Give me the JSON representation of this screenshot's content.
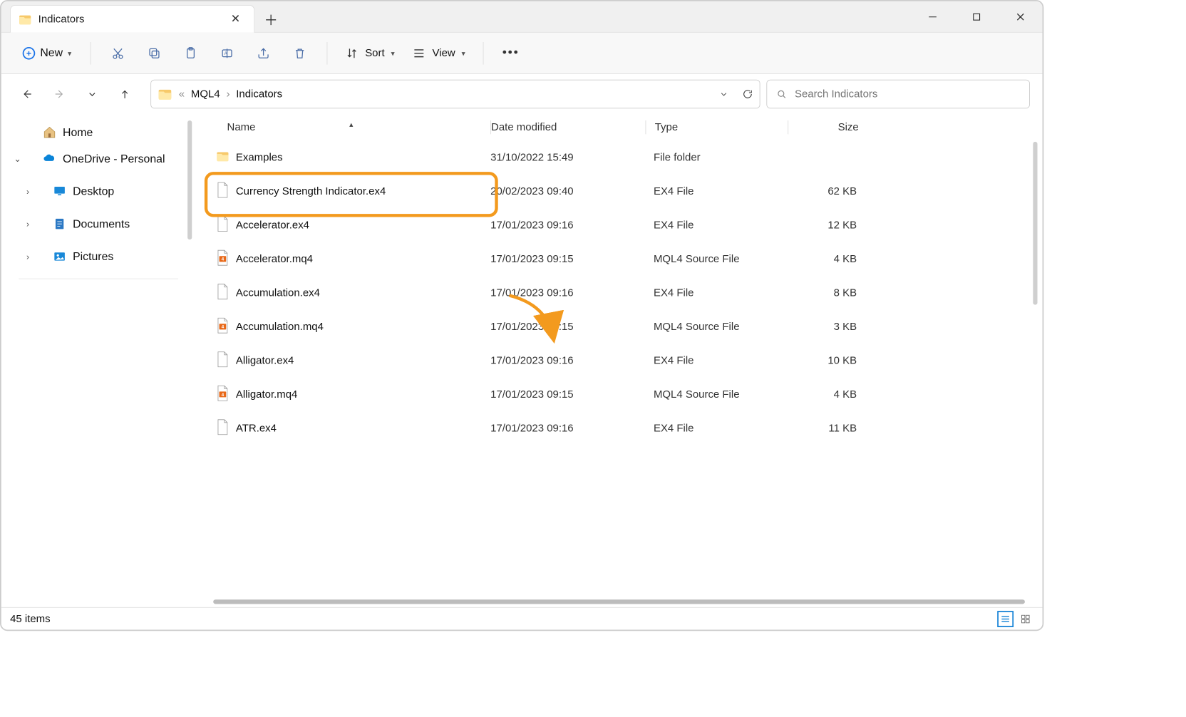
{
  "tab": {
    "title": "Indicators"
  },
  "toolbar": {
    "new_label": "New",
    "sort_label": "Sort",
    "view_label": "View"
  },
  "breadcrumb": {
    "part1": "MQL4",
    "part2": "Indicators"
  },
  "search": {
    "placeholder": "Search Indicators"
  },
  "sidebar": {
    "home": "Home",
    "onedrive": "OneDrive - Personal",
    "desktop": "Desktop",
    "documents": "Documents",
    "pictures": "Pictures"
  },
  "columns": {
    "name": "Name",
    "date": "Date modified",
    "type": "Type",
    "size": "Size"
  },
  "rows": [
    {
      "name": "Examples",
      "date": "31/10/2022 15:49",
      "type": "File folder",
      "size": "",
      "icon": "folder",
      "highlight": false
    },
    {
      "name": "Currency Strength Indicator.ex4",
      "date": "20/02/2023 09:40",
      "type": "EX4 File",
      "size": "62 KB",
      "icon": "ex4",
      "highlight": true
    },
    {
      "name": "Accelerator.ex4",
      "date": "17/01/2023 09:16",
      "type": "EX4 File",
      "size": "12 KB",
      "icon": "ex4",
      "highlight": false
    },
    {
      "name": "Accelerator.mq4",
      "date": "17/01/2023 09:15",
      "type": "MQL4 Source File",
      "size": "4 KB",
      "icon": "mq4",
      "highlight": false
    },
    {
      "name": "Accumulation.ex4",
      "date": "17/01/2023 09:16",
      "type": "EX4 File",
      "size": "8 KB",
      "icon": "ex4",
      "highlight": false
    },
    {
      "name": "Accumulation.mq4",
      "date": "17/01/2023 09:15",
      "type": "MQL4 Source File",
      "size": "3 KB",
      "icon": "mq4",
      "highlight": false
    },
    {
      "name": "Alligator.ex4",
      "date": "17/01/2023 09:16",
      "type": "EX4 File",
      "size": "10 KB",
      "icon": "ex4",
      "highlight": false
    },
    {
      "name": "Alligator.mq4",
      "date": "17/01/2023 09:15",
      "type": "MQL4 Source File",
      "size": "4 KB",
      "icon": "mq4",
      "highlight": false
    },
    {
      "name": "ATR.ex4",
      "date": "17/01/2023 09:16",
      "type": "EX4 File",
      "size": "11 KB",
      "icon": "ex4",
      "highlight": false
    }
  ],
  "status": {
    "count": "45 items"
  }
}
